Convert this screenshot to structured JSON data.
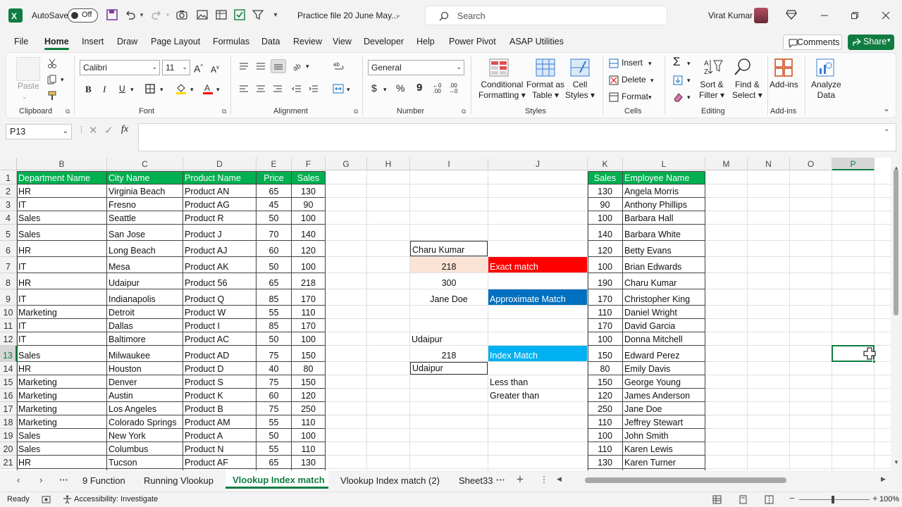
{
  "title_bar": {
    "autosave_label": "AutoSave",
    "autosave_state": "Off",
    "file_name": "Practice file 20 June May...",
    "search_placeholder": "Search",
    "user_name": "Virat Kumar"
  },
  "menu": [
    "File",
    "Home",
    "Insert",
    "Draw",
    "Page Layout",
    "Formulas",
    "Data",
    "Review",
    "View",
    "Developer",
    "Help",
    "Power Pivot",
    "ASAP Utilities"
  ],
  "active_menu": "Home",
  "comments_label": "Comments",
  "share_label": "Share",
  "ribbon": {
    "paste": "Paste",
    "clipboard": "Clipboard",
    "font_name": "Calibri",
    "font_size": "11",
    "font_group": "Font",
    "alignment_group": "Alignment",
    "number_format": "General",
    "number_group": "Number",
    "conditional_formatting": [
      "Conditional",
      "Formatting"
    ],
    "format_as_table": [
      "Format as",
      "Table"
    ],
    "cell_styles": [
      "Cell",
      "Styles"
    ],
    "styles_group": "Styles",
    "insert": "Insert",
    "delete": "Delete",
    "format": "Format",
    "cells_group": "Cells",
    "sort_filter": [
      "Sort &",
      "Filter"
    ],
    "find_select": [
      "Find &",
      "Select"
    ],
    "editing_group": "Editing",
    "addins": "Add-ins",
    "addins_group": "Add-ins",
    "analyze_data": [
      "Analyze",
      "Data"
    ]
  },
  "name_box": "P13",
  "fx": "fx",
  "columns": [
    "B",
    "C",
    "D",
    "E",
    "F",
    "G",
    "H",
    "I",
    "J",
    "K",
    "L",
    "M",
    "N",
    "O",
    "P"
  ],
  "headers": [
    "Department Name",
    "City Name",
    "Product Name",
    "Price",
    "Sales"
  ],
  "rows": [
    [
      "HR",
      "Virginia Beach",
      "Product AN",
      "65",
      "130"
    ],
    [
      "IT",
      "Fresno",
      "Product AG",
      "45",
      "90"
    ],
    [
      "Sales",
      "Seattle",
      "Product R",
      "50",
      "100"
    ],
    [
      "Sales",
      "San Jose",
      "Product J",
      "70",
      "140"
    ],
    [
      "HR",
      "Long Beach",
      "Product AJ",
      "60",
      "120"
    ],
    [
      "IT",
      "Mesa",
      "Product AK",
      "50",
      "100"
    ],
    [
      "HR",
      "Udaipur",
      "Product 56",
      "65",
      "218"
    ],
    [
      "IT",
      "Indianapolis",
      "Product Q",
      "85",
      "170"
    ],
    [
      "Marketing",
      "Detroit",
      "Product W",
      "55",
      "110"
    ],
    [
      "IT",
      "Dallas",
      "Product I",
      "85",
      "170"
    ],
    [
      "IT",
      "Baltimore",
      "Product AC",
      "50",
      "100"
    ],
    [
      "Sales",
      "Milwaukee",
      "Product AD",
      "75",
      "150"
    ],
    [
      "HR",
      "Houston",
      "Product D",
      "40",
      "80"
    ],
    [
      "Marketing",
      "Denver",
      "Product S",
      "75",
      "150"
    ],
    [
      "Marketing",
      "Austin",
      "Product K",
      "60",
      "120"
    ],
    [
      "Marketing",
      "Los Angeles",
      "Product B",
      "75",
      "250"
    ],
    [
      "Marketing",
      "Colorado Springs",
      "Product AM",
      "55",
      "110"
    ],
    [
      "Sales",
      "New York",
      "Product A",
      "50",
      "100"
    ],
    [
      "Sales",
      "Columbus",
      "Product N",
      "55",
      "110"
    ],
    [
      "HR",
      "Tucson",
      "Product AF",
      "65",
      "130"
    ]
  ],
  "kl_headers": [
    "Sales",
    "Employee Name"
  ],
  "kl_rows": [
    [
      "130",
      "Angela Morris"
    ],
    [
      "90",
      "Anthony Phillips"
    ],
    [
      "100",
      "Barbara Hall"
    ],
    [
      "140",
      "Barbara White"
    ],
    [
      "120",
      "Betty Evans"
    ],
    [
      "100",
      "Brian Edwards"
    ],
    [
      "190",
      "Charu Kumar"
    ],
    [
      "170",
      "Christopher King"
    ],
    [
      "110",
      "Daniel Wright"
    ],
    [
      "170",
      "David Garcia"
    ],
    [
      "100",
      "Donna Mitchell"
    ],
    [
      "150",
      "Edward Perez"
    ],
    [
      "80",
      "Emily Davis"
    ],
    [
      "150",
      "George Young"
    ],
    [
      "120",
      "James Anderson"
    ],
    [
      "250",
      "Jane Doe"
    ],
    [
      "110",
      "Jeffrey Stewart"
    ],
    [
      "100",
      "John Smith"
    ],
    [
      "110",
      "Karen Lewis"
    ],
    [
      "130",
      "Karen Turner"
    ]
  ],
  "ij": {
    "i6": "Charu Kumar",
    "i7": "218",
    "j7": "Exact match",
    "i8": "300",
    "i9": "Jane Doe",
    "j9": "Approximate Match",
    "i12": "Udaipur",
    "i13": "218",
    "j13": "Index Match",
    "i14": "Udaipur",
    "j15": "Less than",
    "j16": "Greater than"
  },
  "colors": {
    "excel_green": "#107c41",
    "header_green": "#00b050",
    "exact_red": "#ff0000",
    "approx_blue": "#0070c0",
    "index_cyan": "#00b0f0",
    "peach": "#fbe4d5"
  },
  "sheet_tabs": [
    "9 Function",
    "Running Vlookup",
    "Vlookup Index match",
    "Vlookup Index match (2)",
    "Sheet33"
  ],
  "active_sheet": "Vlookup Index match",
  "status": {
    "ready": "Ready",
    "accessibility": "Accessibility: Investigate",
    "zoom": "100%"
  }
}
